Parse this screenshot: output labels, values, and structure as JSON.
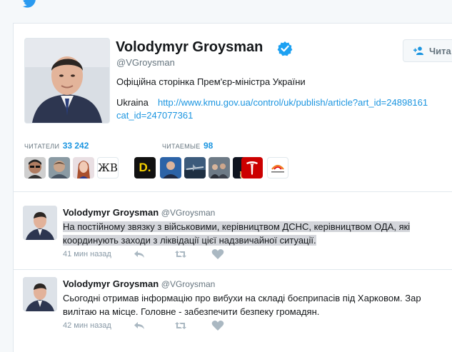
{
  "profile": {
    "name": "Volodymyr Groysman",
    "handle": "@VGroysman",
    "bio": "Офіційна сторінка Прем'єр-міністра України",
    "location": "Ukraina",
    "url_line1": "http://www.kmu.gov.ua/control/uk/publish/article?art_id=24898161",
    "url_line2": "cat_id=247077361",
    "follow_label": "Чита"
  },
  "stats": {
    "followers_label": "ЧИТАТЕЛИ",
    "followers_value": "33 242",
    "following_label": "ЧИТАЕМЫЕ",
    "following_value": "98"
  },
  "follower_thumbs": [
    "avatar-sunglasses",
    "avatar-man",
    "avatar-woman",
    "ЖВ",
    "D."
  ],
  "following_thumbs": [
    "avatar-official",
    "avatar-plane",
    "avatar-group",
    "avatar-rocket",
    "tesla-logo",
    "arcelormittal-logo"
  ],
  "tweets": [
    {
      "name": "Volodymyr Groysman",
      "handle": "@VGroysman",
      "line1": "На постійному звязку з військовими, керівництвом ДСНС, керівництвом ОДА, які",
      "line2": "координують заходи з ліквідації цієї надзвичайної ситуації.",
      "time": "41 мин назад"
    },
    {
      "name": "Volodymyr Groysman",
      "handle": "@VGroysman",
      "line1": "Сьогодні отримав інформацію про вибухи на складі боєприпасів під Харковом. Зар",
      "line2": "вилітаю на місце. Головне  - забезпечити безпеку громадян.",
      "time": "42 мин назад"
    }
  ],
  "colors": {
    "link": "#1b95e0",
    "verified": "#1da1f2",
    "background": "#f5f8fa"
  }
}
